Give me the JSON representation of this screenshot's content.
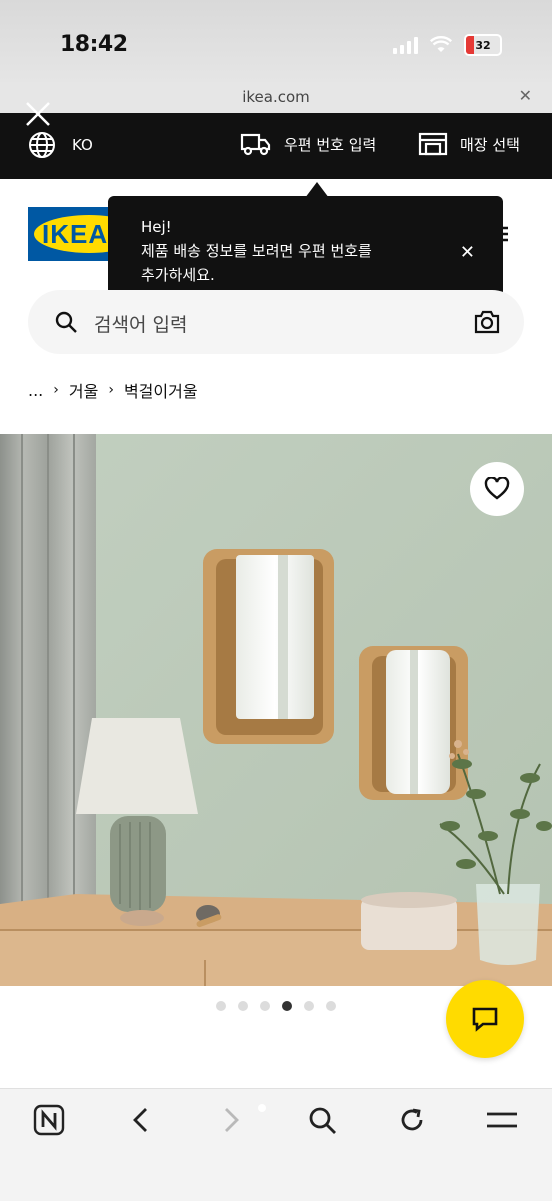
{
  "status_bar": {
    "time": "18:42",
    "battery": "32"
  },
  "browser": {
    "url": "ikea.com"
  },
  "top_bar": {
    "language": "KO",
    "postcode_label": "우편 번호 입력",
    "store_label": "매장 선택"
  },
  "logo": {
    "text": "IKEA"
  },
  "tooltip": {
    "greeting": "Hej!",
    "message_line1": "제품 배송 정보를 보려면 우편 번호를",
    "message_line2": "추가하세요."
  },
  "search": {
    "placeholder": "검색어 입력"
  },
  "breadcrumb": {
    "items": [
      "...",
      "거울",
      "벽걸이거울"
    ]
  },
  "carousel": {
    "total": 6,
    "active_index": 3
  },
  "colors": {
    "ikea_blue": "#0058a3",
    "ikea_yellow": "#ffdb00",
    "bar_black": "#111111"
  },
  "icons": [
    "globe-icon",
    "truck-icon",
    "store-icon",
    "search-icon",
    "camera-icon",
    "heart-icon",
    "chat-icon",
    "close-icon",
    "naver-icon",
    "back-icon",
    "forward-icon",
    "reload-icon",
    "menu-icon"
  ]
}
